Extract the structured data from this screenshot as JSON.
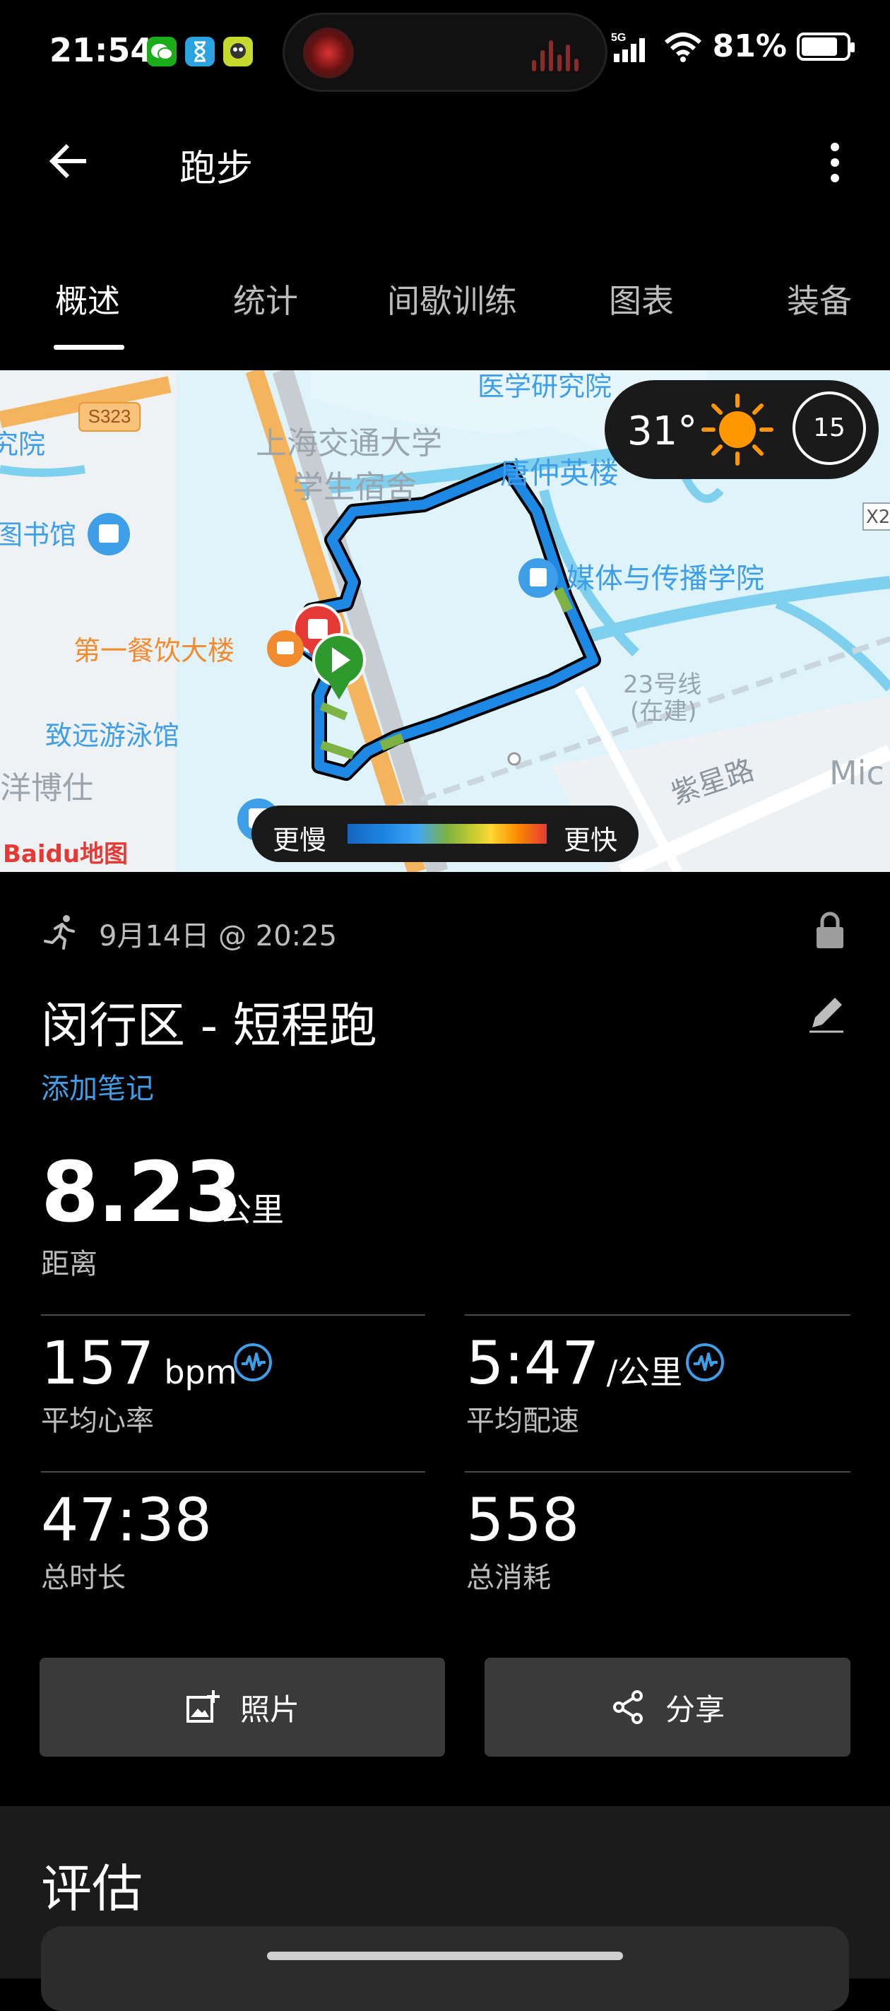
{
  "status_bar": {
    "time": "21:54",
    "network": "5G",
    "battery": "81%",
    "battery_level": 0.81,
    "icons": [
      "wechat-icon",
      "hourglass-icon",
      "game-app-icon",
      "signal-icon",
      "wifi-icon",
      "battery-icon"
    ]
  },
  "header": {
    "title": "跑步"
  },
  "tabs": [
    {
      "label": "概述"
    },
    {
      "label": "统计"
    },
    {
      "label": "间歇训练"
    },
    {
      "label": "图表"
    },
    {
      "label": "装备"
    }
  ],
  "map": {
    "weather_temp": "31°",
    "wind_speed": "15",
    "legend_slow": "更慢",
    "legend_fast": "更快",
    "labels": {
      "road_s323": "S323",
      "med_inst": "医学研究院",
      "univ_1": "上海交通大学",
      "univ_2": "学生宿舍",
      "tang": "唐仲英楼",
      "library": "图书馆",
      "media": "媒体与传播学院",
      "canteen": "第一餐饮大楼",
      "metro_1": "23号线",
      "metro_2": "(在建)",
      "pool": "致远游泳馆",
      "road_zixing": "紫星路",
      "left_edge_1": "究院",
      "left_edge_2": "洋博仕",
      "edge_mic": "Mic",
      "edge_x2": "X2",
      "baidu_logo": "Baidu地图"
    }
  },
  "activity": {
    "datetime": "9月14日 @ 20:25",
    "title": "闵行区 - 短程跑",
    "add_note": "添加笔记",
    "distance_value": "8.23",
    "distance_unit": "公里",
    "distance_label": "距离",
    "stats": {
      "hr_value": "157",
      "hr_unit": "bpm",
      "hr_label": "平均心率",
      "pace_value": "5:47",
      "pace_unit": "/公里",
      "pace_label": "平均配速",
      "duration_value": "47:38",
      "duration_label": "总时长",
      "calories_value": "558",
      "calories_label": "总消耗"
    }
  },
  "buttons": {
    "photo": "照片",
    "share": "分享"
  },
  "evaluation": {
    "heading": "评估"
  },
  "colors": {
    "accent_link": "#3f9ee8",
    "route_blue": "#1e88e5",
    "start_green": "#2e9a2e",
    "end_red": "#e53935",
    "button_bg": "#3a3a3a"
  }
}
